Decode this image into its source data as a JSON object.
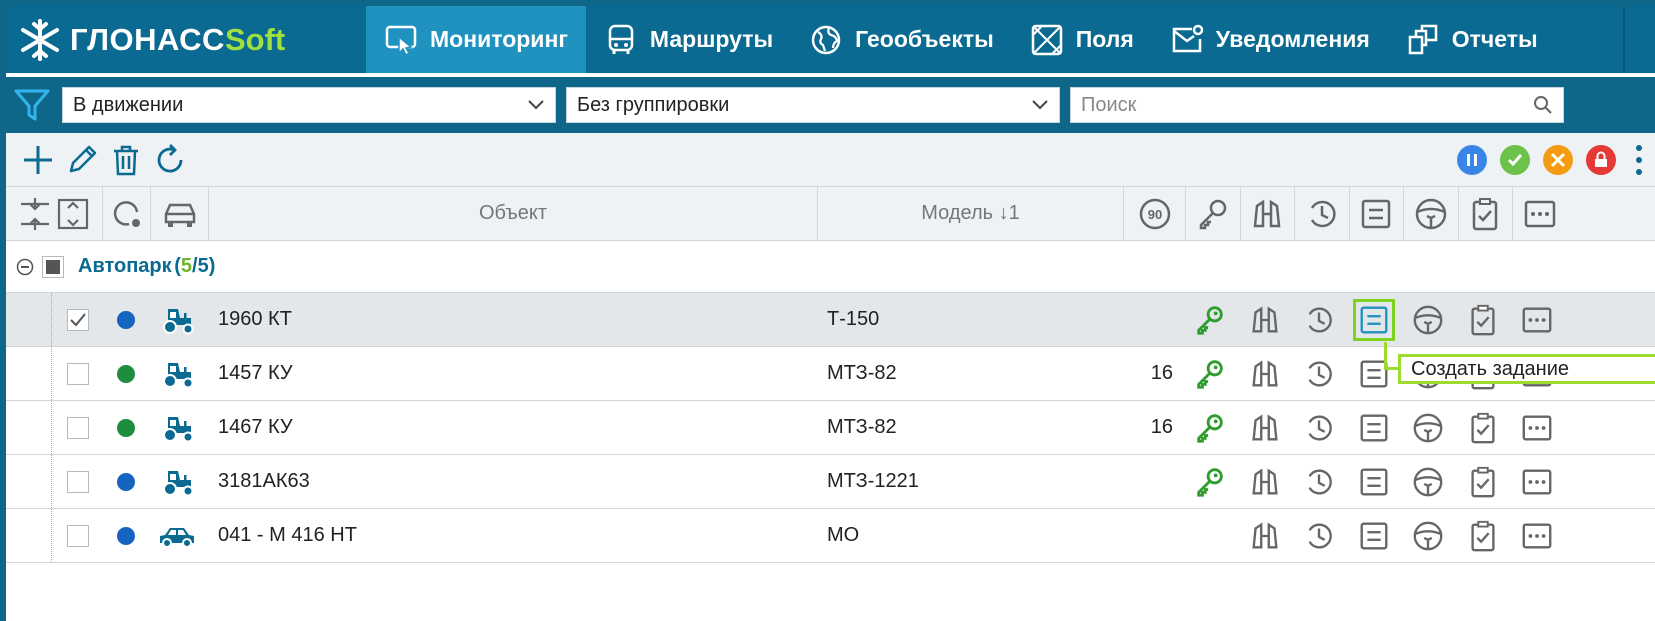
{
  "brand": {
    "part1": "ГЛОНАСС",
    "part2": "Soft"
  },
  "nav": [
    {
      "label": "Мониторинг",
      "icon": "monitoring-icon",
      "active": true
    },
    {
      "label": "Маршруты",
      "icon": "bus-icon"
    },
    {
      "label": "Геообъекты",
      "icon": "globe-icon"
    },
    {
      "label": "Поля",
      "icon": "field-icon"
    },
    {
      "label": "Уведомления",
      "icon": "notification-icon"
    },
    {
      "label": "Отчеты",
      "icon": "reports-icon"
    }
  ],
  "filters": {
    "state": "В движении",
    "grouping": "Без группировки",
    "search_placeholder": "Поиск"
  },
  "columns": {
    "object": "Объект",
    "model": "Модель ↓1",
    "speed_badge": "90"
  },
  "group": {
    "name": "Автопарк",
    "open": "(",
    "active": "5",
    "sep": "/",
    "total": "5",
    "close": ")"
  },
  "rows": [
    {
      "object": "1960 КТ",
      "model": "Т-150",
      "speed": "",
      "status_color": "#1565c0",
      "type": "tractor",
      "checked": true,
      "key": true
    },
    {
      "object": "1457 КУ",
      "model": "МТЗ-82",
      "speed": "16",
      "status_color": "#1e8e3e",
      "type": "tractor",
      "checked": false,
      "key": true
    },
    {
      "object": "1467 КУ",
      "model": "МТЗ-82",
      "speed": "16",
      "status_color": "#1e8e3e",
      "type": "tractor",
      "checked": false,
      "key": true
    },
    {
      "object": "3181АК63",
      "model": "МТЗ-1221",
      "speed": "",
      "status_color": "#1565c0",
      "type": "tractor",
      "checked": false,
      "key": true
    },
    {
      "object": "041 - М 416 НТ",
      "model": "МО",
      "speed": "",
      "status_color": "#1565c0",
      "type": "car",
      "checked": false,
      "key": false
    }
  ],
  "tooltip": "Создать задание",
  "colors": {
    "primary": "#0a6a91",
    "active_tab": "#1f92c0",
    "accent_green": "#9ee040",
    "highlight": "#7ed321"
  }
}
